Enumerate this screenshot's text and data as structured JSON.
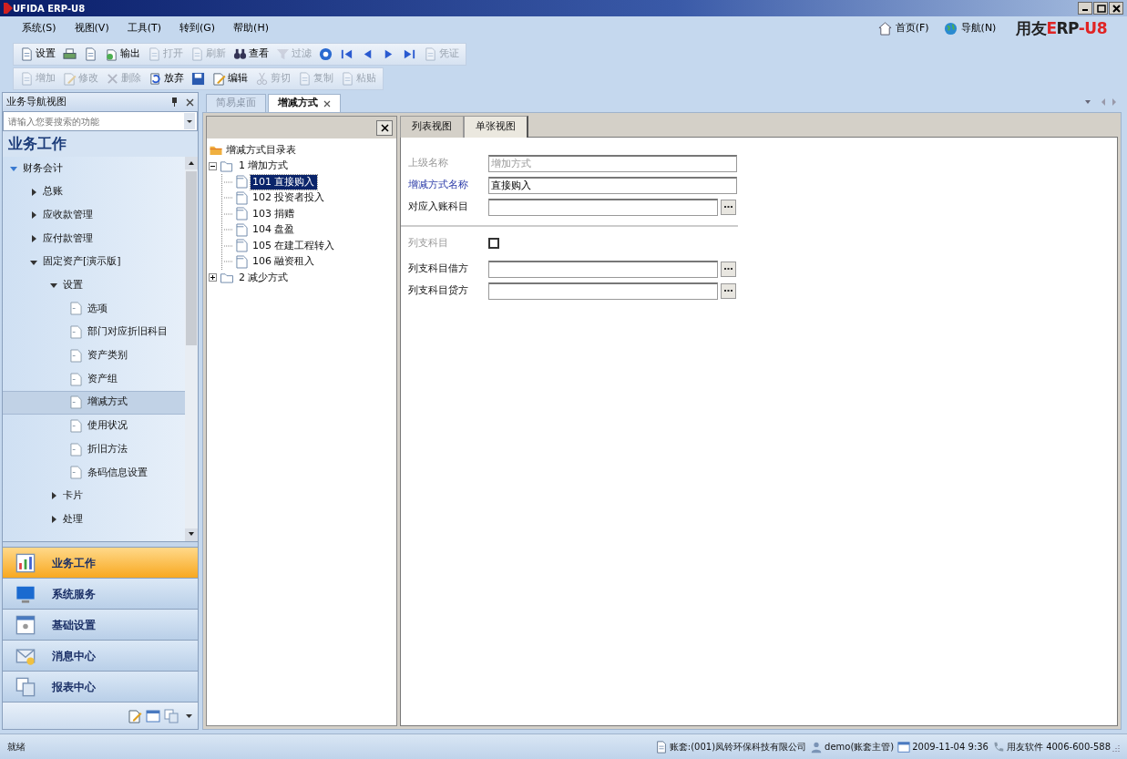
{
  "window": {
    "title": "UFIDA ERP-U8"
  },
  "menu": [
    "系统(S)",
    "视图(V)",
    "工具(T)",
    "转到(G)",
    "帮助(H)"
  ],
  "header_links": [
    {
      "label": "首页(F)"
    },
    {
      "label": "导航(N)"
    }
  ],
  "logo": [
    {
      "text": "用友",
      "color": "#222222"
    },
    {
      "text": "E",
      "color": "#e02424"
    },
    {
      "text": "RP",
      "color": "#222222"
    },
    {
      "text": "-U8",
      "color": "#e02424"
    }
  ],
  "toolbars": [
    [
      {
        "label": "设置",
        "disabled": false
      },
      {
        "disabled": false
      },
      {
        "disabled": false
      },
      {
        "label": "输出",
        "disabled": false
      },
      {
        "label": "打开",
        "disabled": true
      },
      {
        "label": "刷新",
        "disabled": true
      },
      {
        "label": "查看",
        "disabled": false
      },
      {
        "label": "过滤",
        "disabled": true
      },
      {
        "disabled": false
      },
      {
        "disabled": false
      },
      {
        "disabled": false
      },
      {
        "disabled": false
      },
      {
        "disabled": false
      },
      {
        "label": "凭证",
        "disabled": true
      }
    ],
    [
      {
        "label": "增加",
        "disabled": true
      },
      {
        "label": "修改",
        "disabled": true
      },
      {
        "label": "删除",
        "disabled": true
      },
      {
        "label": "放弃",
        "disabled": false
      },
      {
        "disabled": false
      },
      {
        "label": "编辑",
        "disabled": false
      },
      {
        "label": "剪切",
        "disabled": true
      },
      {
        "label": "复制",
        "disabled": true
      },
      {
        "label": "粘贴",
        "disabled": true
      }
    ]
  ],
  "nav_pane": {
    "title": "业务导航视图",
    "search": {
      "placeholder": "请输入您要搜索的功能"
    },
    "section": "业务工作",
    "tree": [
      {
        "label": "财务会计",
        "expanded": true,
        "children": [
          {
            "label": "总账",
            "expanded": false
          },
          {
            "label": "应收款管理",
            "expanded": false
          },
          {
            "label": "应付款管理",
            "expanded": false
          },
          {
            "label": "固定资产[演示版]",
            "expanded": true,
            "children": [
              {
                "label": "设置",
                "expanded": true,
                "children": [
                  {
                    "label": "选项",
                    "selected": false
                  },
                  {
                    "label": "部门对应折旧科目",
                    "selected": false
                  },
                  {
                    "label": "资产类别",
                    "selected": false
                  },
                  {
                    "label": "资产组",
                    "selected": false
                  },
                  {
                    "label": "增减方式",
                    "selected": true
                  },
                  {
                    "label": "使用状况",
                    "selected": false
                  },
                  {
                    "label": "折旧方法",
                    "selected": false
                  },
                  {
                    "label": "条码信息设置",
                    "selected": false
                  }
                ]
              },
              {
                "label": "卡片",
                "expanded": false
              },
              {
                "label": "处理",
                "expanded": false
              }
            ]
          }
        ]
      }
    ],
    "nav_buttons": [
      {
        "label": "业务工作",
        "selected": true
      },
      {
        "label": "系统服务",
        "selected": false
      },
      {
        "label": "基础设置",
        "selected": false
      },
      {
        "label": "消息中心",
        "selected": false
      },
      {
        "label": "报表中心",
        "selected": false
      }
    ]
  },
  "tabs": [
    {
      "label": "简易桌面",
      "selected": false,
      "closable": false
    },
    {
      "label": "增减方式",
      "selected": true,
      "closable": true
    }
  ],
  "category_tree": {
    "root": "增减方式目录表",
    "children": [
      {
        "label": "1 增加方式",
        "expanded": true,
        "children": [
          {
            "label": "101 直接购入",
            "selected": true
          },
          {
            "label": "102 投资者投入",
            "selected": false
          },
          {
            "label": "103 捐赠",
            "selected": false
          },
          {
            "label": "104 盘盈",
            "selected": false
          },
          {
            "label": "105 在建工程转入",
            "selected": false
          },
          {
            "label": "106 融资租入",
            "selected": false
          }
        ]
      },
      {
        "label": "2 减少方式",
        "expanded": false
      }
    ]
  },
  "view_tabs": [
    {
      "label": "列表视图",
      "selected": false
    },
    {
      "label": "单张视图",
      "selected": true
    }
  ],
  "form": [
    [
      {
        "label": "上级名称",
        "kind": "text",
        "value": "增加方式",
        "disabled": true,
        "required": false
      },
      {
        "label": "增减方式名称",
        "kind": "text",
        "value": "直接购入",
        "disabled": false,
        "required": true
      },
      {
        "label": "对应入账科目",
        "kind": "lookup",
        "disabled": false,
        "required": false
      }
    ],
    [
      {
        "label": "列支科目",
        "kind": "checkbox",
        "checked": false,
        "disabled": true,
        "required": false
      },
      {
        "label": "列支科目借方",
        "kind": "lookup",
        "disabled": false,
        "required": false
      },
      {
        "label": "列支科目贷方",
        "kind": "lookup",
        "disabled": false,
        "required": false
      }
    ]
  ],
  "status_bar": {
    "text": "就绪",
    "items": [
      "账套:(001)凤铃环保科技有限公司",
      "demo(账套主管)",
      "2009-11-04 9:36",
      "用友软件 4006-600-588"
    ]
  }
}
